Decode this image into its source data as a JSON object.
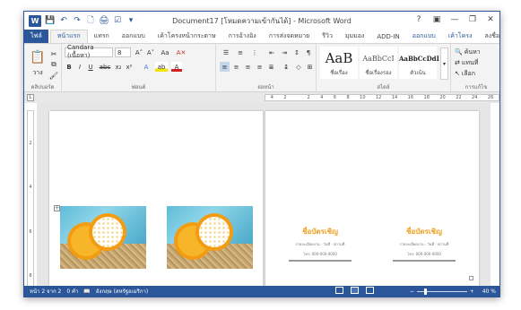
{
  "window": {
    "title": "Document17 [โหมดความเข้ากันได้] - Microsoft Word",
    "app_icon_letter": "W",
    "controls": [
      "?",
      "▣",
      "—",
      "❐",
      "✕"
    ]
  },
  "qat": [
    "💾",
    "↶",
    "↷",
    "🗋",
    "🖨",
    "☑",
    "▾"
  ],
  "tabs": {
    "file": "ไฟล์",
    "items": [
      "หน้าแรก",
      "แทรก",
      "ออกแบบ",
      "เค้าโครงหน้ากระดาษ",
      "การอ้างอิง",
      "การส่งจดหมาย",
      "รีวิว",
      "มุมมอง",
      "ADD-IN",
      "ออกแบบ",
      "เค้าโครง"
    ],
    "active_index": 0,
    "signin": "ลงชื่อเข้าใช้"
  },
  "ribbon": {
    "clipboard": {
      "paste": "วาง",
      "label": "คลิปบอร์ด"
    },
    "font": {
      "name": "Candara (เนื้อหา)",
      "size": "8",
      "grow": "A˄",
      "shrink": "A˅",
      "case": "Aa",
      "clear": "A✕",
      "bold": "B",
      "italic": "I",
      "underline": "U",
      "strike": "abc",
      "subscript": "x₂",
      "superscript": "x²",
      "effects": "A",
      "highlight": "ab",
      "color": "A",
      "label": "ฟอนต์"
    },
    "paragraph": {
      "label": "ย่อหน้า",
      "pilcrow": "¶"
    },
    "styles": {
      "items": [
        {
          "sample": "AaB",
          "name": "ชื่อเรื่อง"
        },
        {
          "sample": "AaBbCcI",
          "name": "ชื่อเรื่องรอง"
        },
        {
          "sample": "AaBbCcDdI",
          "name": "ตัวเน้น"
        }
      ],
      "label": "สไตล์"
    },
    "editing": {
      "find": "ค้นหา",
      "replace": "แทนที่",
      "select": "เลือก",
      "label": "การแก้ไข"
    }
  },
  "ruler": {
    "corner": "L",
    "hticks": [
      "4",
      "2",
      "",
      "2",
      "4",
      "6",
      "8",
      "10",
      "12",
      "14",
      "16",
      "18",
      "20",
      "22",
      "24",
      "26"
    ],
    "vticks": [
      "",
      "2",
      "",
      "4",
      "",
      "6",
      "",
      "8"
    ]
  },
  "document": {
    "card": {
      "heading": "ชื่อบัตรเชิญ",
      "small1": "รายละเอียดงาน · วันที่ · สถานที่",
      "small2": "โทร: 000-000-0000"
    }
  },
  "status": {
    "page": "หน้า 2 จาก 2",
    "words": "0 คำ",
    "language": "อังกฤษ (สหรัฐอเมริกา)",
    "zoom_minus": "−",
    "zoom_plus": "+",
    "zoom": "40 %",
    "zoom_percent": 40
  },
  "colors": {
    "accent": "#2b579a",
    "card_heading": "#f0a020"
  }
}
